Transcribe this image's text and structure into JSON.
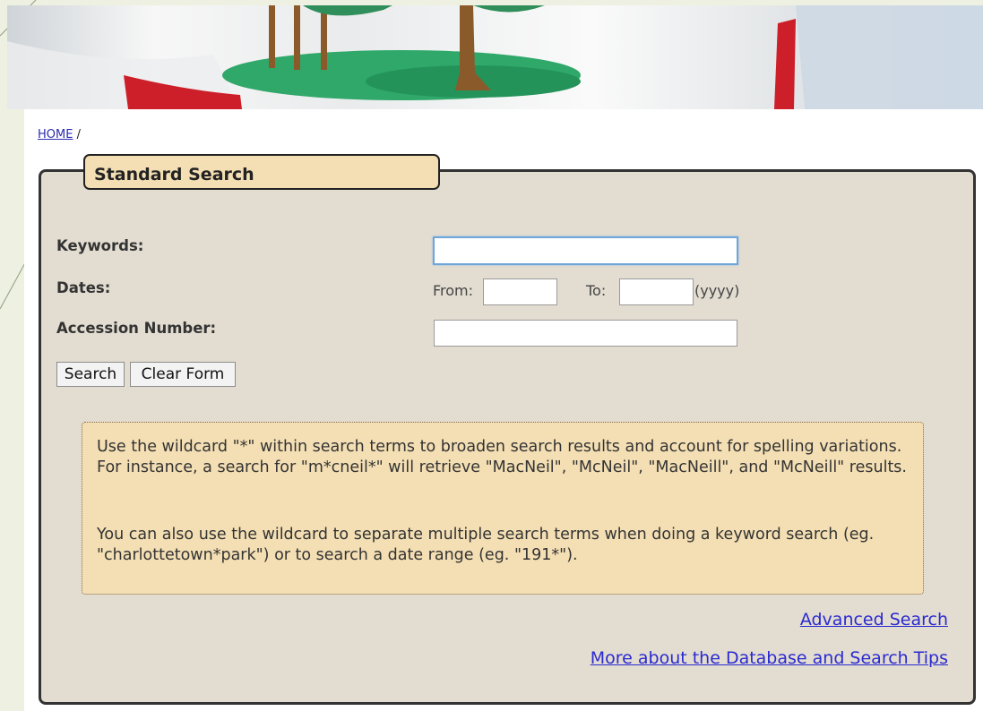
{
  "breadcrumb": {
    "home": "HOME",
    "separator": "/"
  },
  "panel": {
    "title": "Standard Search"
  },
  "form": {
    "keywords_label": "Keywords:",
    "keywords_value": "",
    "dates_label": "Dates:",
    "from_label": "From:",
    "from_value": "",
    "to_label": "To:",
    "to_value": "",
    "date_format": "(yyyy)",
    "accession_label": "Accession Number:",
    "accession_value": ""
  },
  "buttons": {
    "search": "Search",
    "clear": "Clear Form"
  },
  "tips": {
    "paragraph1": "Use the wildcard \"*\" within search terms to broaden search results and account for spelling variations. For instance, a search for \"m*cneil*\" will retrieve \"MacNeil\", \"McNeil\", \"MacNeill\", and \"McNeill\" results.",
    "paragraph2": "You can also use the wildcard to separate multiple search terms when doing a keyword search (eg. \"charlottetown*park\") or to search a date range (eg. \"191*\")."
  },
  "links": {
    "advanced": "Advanced Search",
    "more": "More about the Database and Search Tips"
  },
  "colors": {
    "panel_bg": "#e3ddd1",
    "tab_bg": "#f4dfb4",
    "link": "#2a2ad0",
    "flag_red": "#cc1f2a",
    "flag_green": "#2fa86a"
  }
}
